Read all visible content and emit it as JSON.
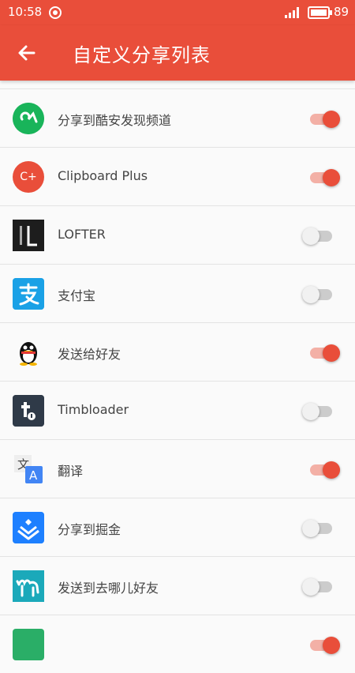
{
  "status": {
    "time": "10:58",
    "battery": "89"
  },
  "header": {
    "title": "自定义分享列表"
  },
  "items": [
    {
      "label": "分享到酷安发现频道",
      "enabled": true,
      "icon": "coolapk-icon"
    },
    {
      "label": "Clipboard Plus",
      "enabled": true,
      "icon": "clipboard-plus-icon"
    },
    {
      "label": "LOFTER",
      "enabled": false,
      "icon": "lofter-icon"
    },
    {
      "label": "支付宝",
      "enabled": false,
      "icon": "alipay-icon"
    },
    {
      "label": "发送给好友",
      "enabled": true,
      "icon": "qq-penguin-icon"
    },
    {
      "label": "Timbloader",
      "enabled": false,
      "icon": "timbloader-icon"
    },
    {
      "label": "翻译",
      "enabled": true,
      "icon": "translate-icon"
    },
    {
      "label": "分享到掘金",
      "enabled": false,
      "icon": "juejin-icon"
    },
    {
      "label": "发送到去哪儿好友",
      "enabled": false,
      "icon": "qunar-icon"
    },
    {
      "label": "",
      "enabled": true,
      "icon": "wechat-icon"
    }
  ],
  "colors": {
    "accent": "#e94e3a",
    "accent_track": "#f3b0a6"
  }
}
